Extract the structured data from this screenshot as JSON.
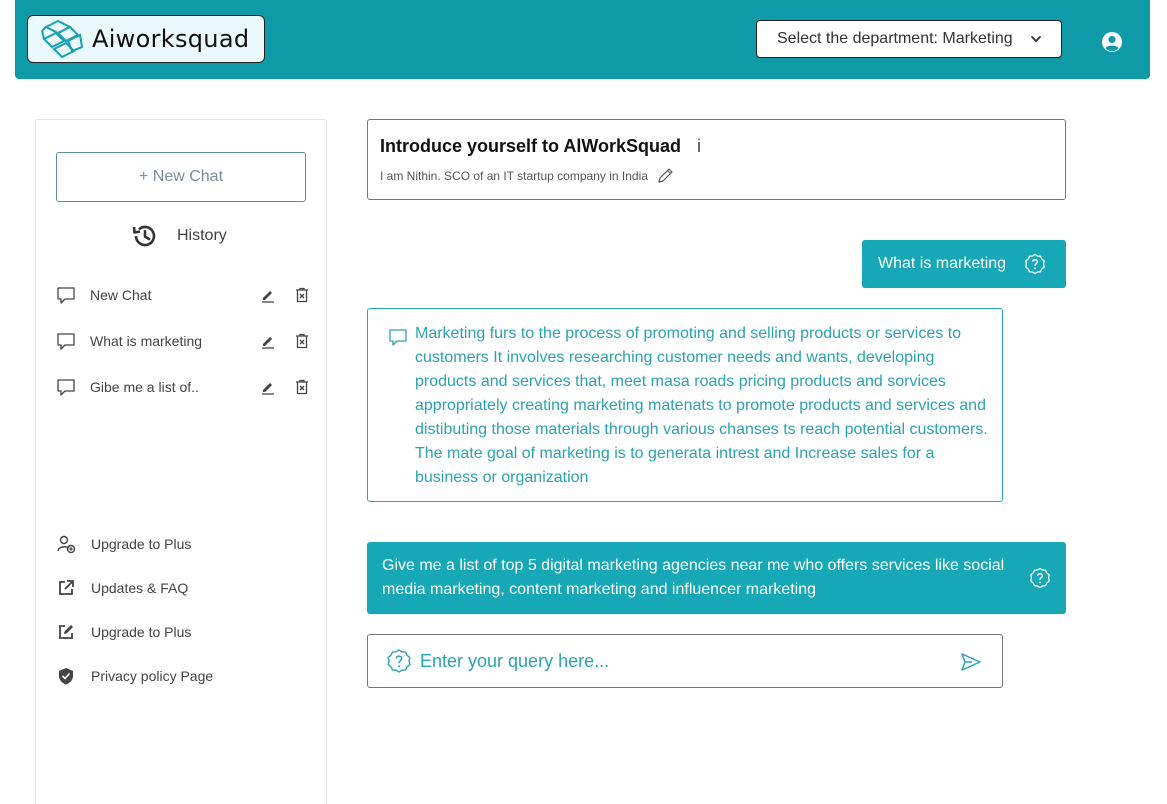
{
  "header": {
    "brand": "Aiworksquad",
    "department_select": "Select the department: Marketing"
  },
  "sidebar": {
    "new_chat_label": "+ New Chat",
    "history_label": "History",
    "chats": [
      {
        "label": "New Chat"
      },
      {
        "label": "What is marketing"
      },
      {
        "label": "Gibe me a list of.."
      }
    ],
    "menu": [
      {
        "label": "Upgrade to Plus",
        "icon": "user-plus-icon"
      },
      {
        "label": "Updates & FAQ",
        "icon": "external-link-icon"
      },
      {
        "label": "Upgrade to Plus",
        "icon": "edit-square-icon"
      },
      {
        "label": "Privacy policy Page",
        "icon": "shield-icon"
      }
    ]
  },
  "intro": {
    "title": "Introduce yourself to AlWorkSquad",
    "info": "i",
    "subtitle": "I am Nithin. SCO of an IT startup company in India"
  },
  "conversation": {
    "question1": "What is marketing",
    "answer1": "Marketing furs to the process of promoting and selling products or services to customers It involves researching customer needs and wants, developing products and services that, meet masa roads pricing products and sorvices appropriately creating marketing matenats to promote products and services and distibuting those materials through various chanses ts reach potential customers. The mate goal of marketing is to generata intrest and Increase sales for a business or organization",
    "question2": "Give me a list of top 5 digital marketing agencies near me who offers services like social media marketing, content marketing and influencer marketing"
  },
  "query": {
    "placeholder": "Enter your query here..."
  },
  "colors": {
    "brand": "#0e9aa7",
    "bubble": "#16a8b7",
    "answer_text": "#2aa3b2"
  }
}
